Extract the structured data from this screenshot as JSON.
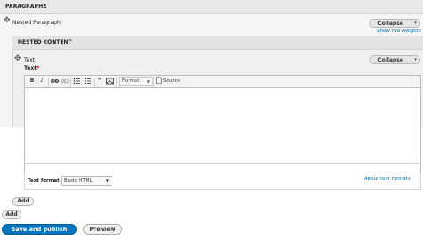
{
  "paragraphs": {
    "header": "PARAGRAPHS",
    "item": {
      "label": "Nested Paragraph",
      "collapse_label": "Collapse",
      "show_row_weights": "Show row weights"
    },
    "add_label": "Add"
  },
  "nested": {
    "header": "NESTED CONTENT",
    "item": {
      "label": "Text",
      "collapse_label": "Collapse"
    },
    "field_label": "Text",
    "required_mark": "*",
    "toolbar": {
      "bold": "B",
      "italic": "I",
      "link": "link-icon",
      "unlink": "unlink-icon",
      "bulleted_list": "bulleted-list-icon",
      "numbered_list": "numbered-list-icon",
      "blockquote": "❞",
      "image": "image-icon",
      "format_label": "Format",
      "source_label": "Source"
    },
    "text_format_label": "Text format",
    "text_format_value": "Basic HTML",
    "about_text_formats": "About text formats",
    "add_label": "Add"
  },
  "actions": {
    "save_label": "Save and publish",
    "preview_label": "Preview"
  },
  "colors": {
    "primary": "#0074bd",
    "link": "#0071b8",
    "required": "#ee0000"
  }
}
